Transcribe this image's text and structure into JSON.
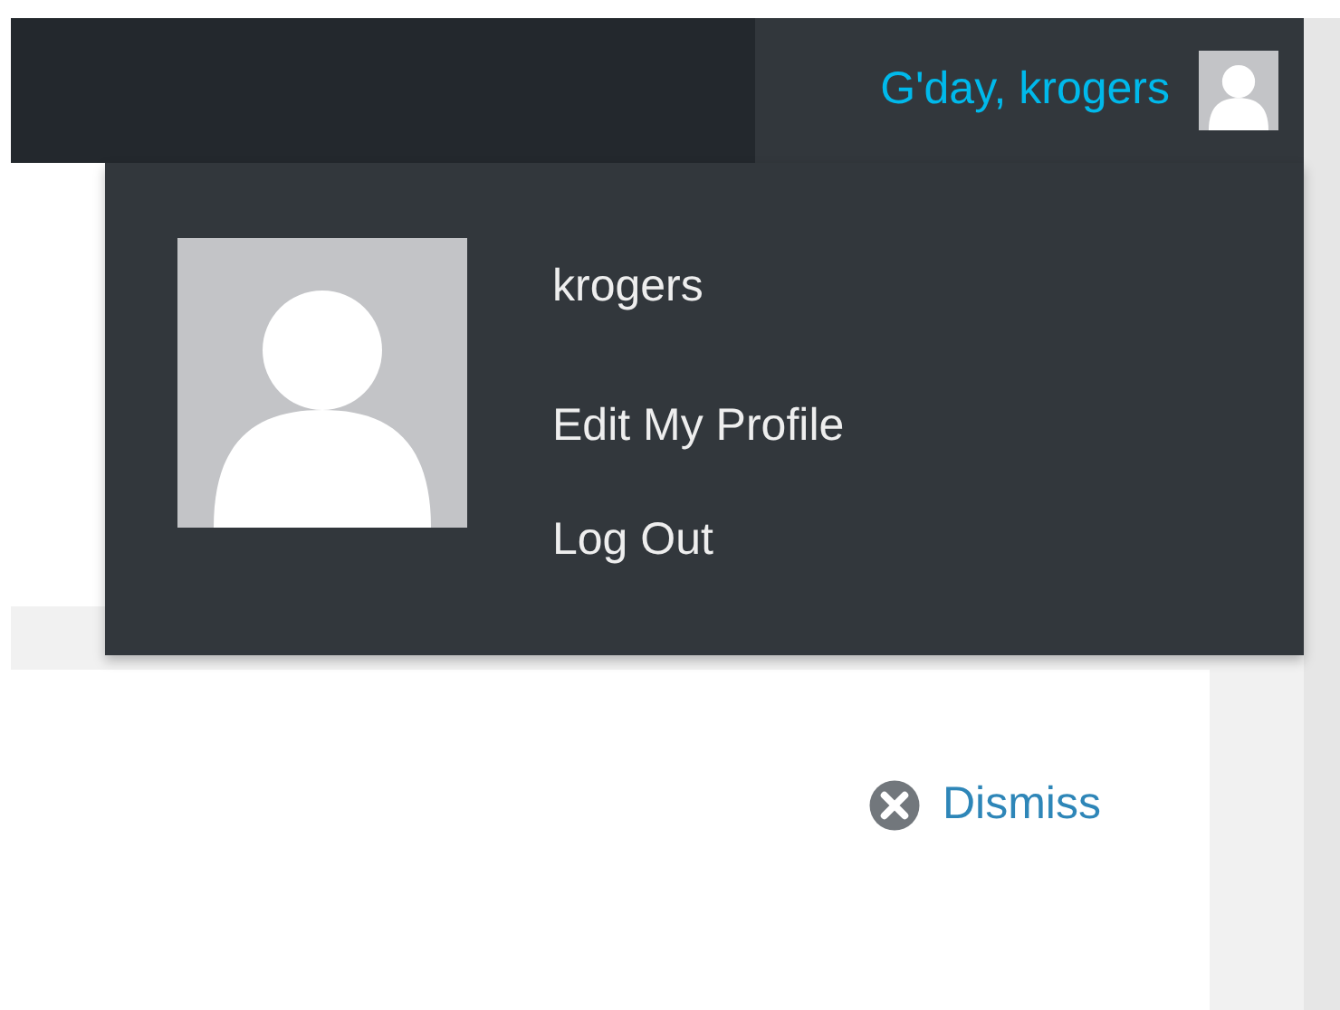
{
  "toolbar": {
    "greeting": "G'day, krogers"
  },
  "account_menu": {
    "username": "krogers",
    "items": [
      {
        "label": "Edit My Profile"
      },
      {
        "label": "Log Out"
      }
    ]
  },
  "notice": {
    "dismiss": "Dismiss"
  }
}
